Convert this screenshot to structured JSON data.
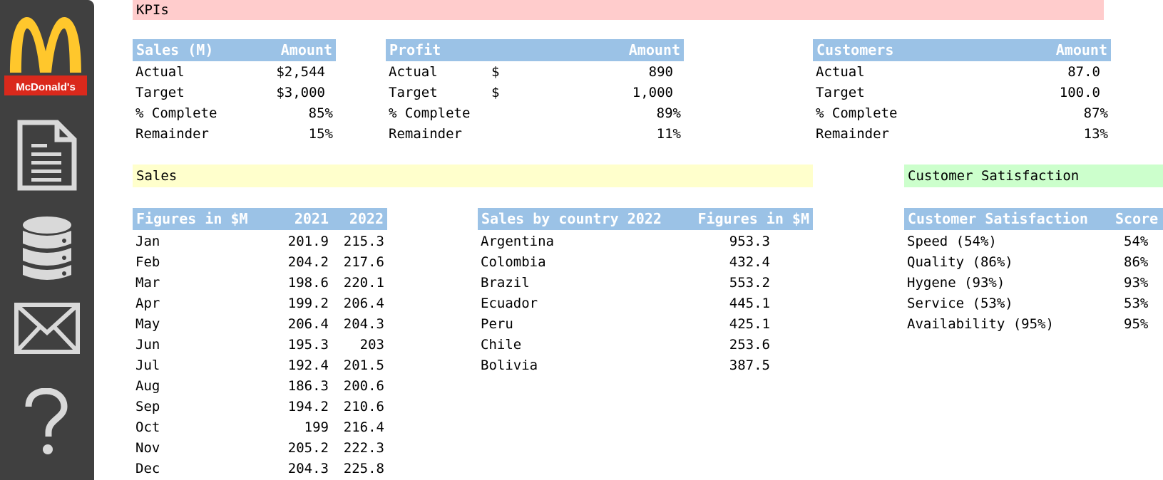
{
  "brand": {
    "logo_text": "McDonald's"
  },
  "nav": [
    {
      "name": "document-icon"
    },
    {
      "name": "database-icon"
    },
    {
      "name": "mail-icon"
    },
    {
      "name": "help-icon"
    }
  ],
  "colors": {
    "kpi_banner": "#ffcccc",
    "sales_banner": "#ffffcc",
    "satisfaction_banner": "#ccffcc",
    "header": "#9bc2e6",
    "sidebar": "#404040"
  },
  "kpis": {
    "title": "KPIs",
    "sales": {
      "headers": [
        "Sales (M)",
        "Amount"
      ],
      "rows": [
        {
          "label": "Actual",
          "value": "$2,544"
        },
        {
          "label": "Target",
          "value": "$3,000"
        },
        {
          "label": "% Complete",
          "value": "85%"
        },
        {
          "label": "Remainder",
          "value": "15%"
        }
      ]
    },
    "profit": {
      "headers": [
        "Profit",
        "Amount"
      ],
      "rows": [
        {
          "label": "Actual",
          "currency": "$",
          "value": "890"
        },
        {
          "label": "Target",
          "currency": "$",
          "value": "1,000"
        },
        {
          "label": "% Complete",
          "currency": "",
          "value": "89%"
        },
        {
          "label": "Remainder",
          "currency": "",
          "value": "11%"
        }
      ]
    },
    "customers": {
      "headers": [
        "Customers",
        "Amount"
      ],
      "rows": [
        {
          "label": "Actual",
          "value": "87.0"
        },
        {
          "label": "Target",
          "value": "100.0"
        },
        {
          "label": "% Complete",
          "value": "87%"
        },
        {
          "label": "Remainder",
          "value": "13%"
        }
      ]
    }
  },
  "sales": {
    "title": "Sales",
    "monthly": {
      "headers": [
        "Figures in $M",
        "2021",
        "2022"
      ],
      "rows": [
        [
          "Jan",
          "201.9",
          "215.3"
        ],
        [
          "Feb",
          "204.2",
          "217.6"
        ],
        [
          "Mar",
          "198.6",
          "220.1"
        ],
        [
          "Apr",
          "199.2",
          "206.4"
        ],
        [
          "May",
          "206.4",
          "204.3"
        ],
        [
          "Jun",
          "195.3",
          "203"
        ],
        [
          "Jul",
          "192.4",
          "201.5"
        ],
        [
          "Aug",
          "186.3",
          "200.6"
        ],
        [
          "Sep",
          "194.2",
          "210.6"
        ],
        [
          "Oct",
          "199",
          "216.4"
        ],
        [
          "Nov",
          "205.2",
          "222.3"
        ],
        [
          "Dec",
          "204.3",
          "225.8"
        ]
      ]
    },
    "by_country": {
      "headers": [
        "Sales by country 2022",
        "Figures in $M"
      ],
      "rows": [
        [
          "Argentina",
          "953.3"
        ],
        [
          "Colombia",
          "432.4"
        ],
        [
          "Brazil",
          "553.2"
        ],
        [
          "Ecuador",
          "445.1"
        ],
        [
          "Peru",
          "425.1"
        ],
        [
          "Chile",
          "253.6"
        ],
        [
          "Bolivia",
          "387.5"
        ]
      ]
    }
  },
  "satisfaction": {
    "title": "Customer Satisfaction",
    "headers": [
      "Customer Satisfaction",
      "Score"
    ],
    "rows": [
      [
        "Speed (54%)",
        "54%"
      ],
      [
        "Quality (86%)",
        "86%"
      ],
      [
        "Hygene (93%)",
        "93%"
      ],
      [
        "Service (53%)",
        "53%"
      ],
      [
        "Availability (95%)",
        "95%"
      ]
    ]
  }
}
